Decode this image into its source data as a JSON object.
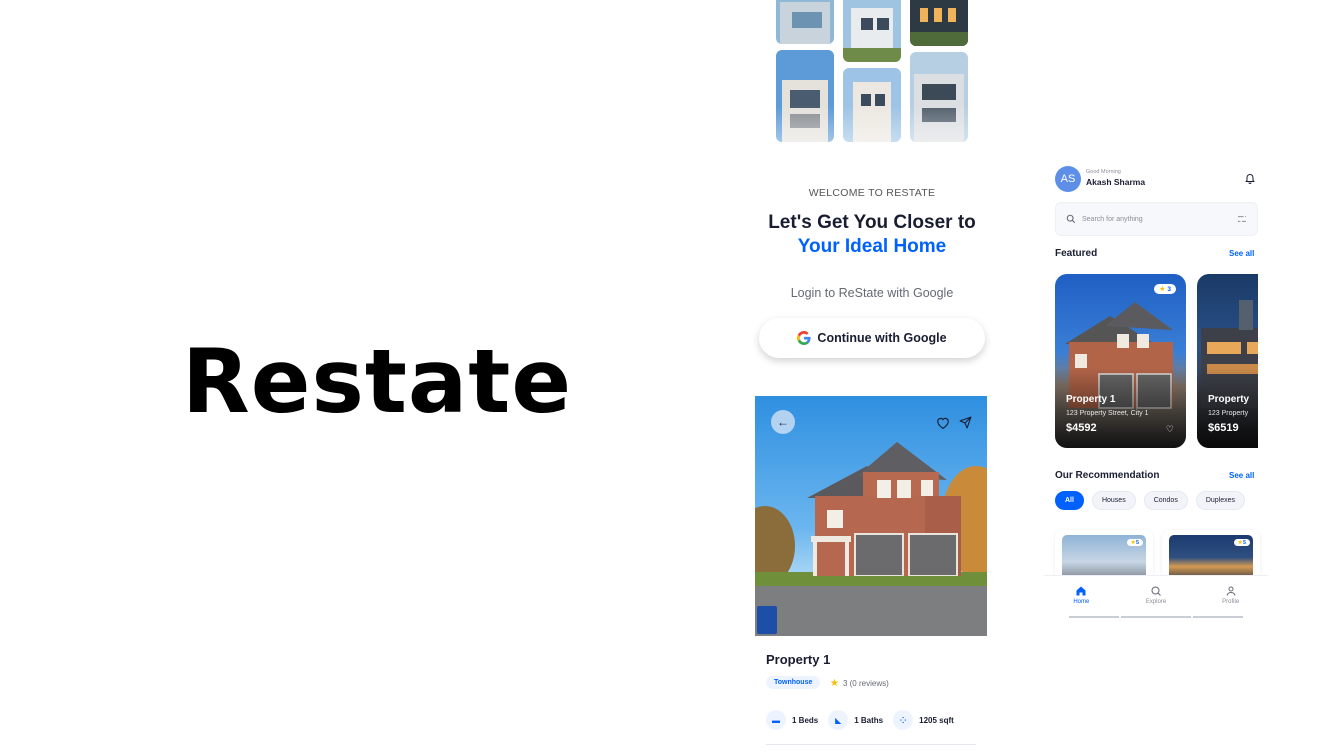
{
  "brand": {
    "title": "Restate"
  },
  "signin": {
    "welcome": "WELCOME TO RESTATE",
    "headline_line1": "Let's Get You Closer to",
    "headline_line2": "Your Ideal Home",
    "login_with": "Login to ReState with Google",
    "google_button": "Continue with Google"
  },
  "detail": {
    "title": "Property 1",
    "tag": "Townhouse",
    "rating": "3 (0 reviews)",
    "facts": [
      {
        "label": "1 Beds",
        "icon": "bed-icon"
      },
      {
        "label": "1 Baths",
        "icon": "bath-icon"
      },
      {
        "label": "1205 sqft",
        "icon": "area-icon"
      }
    ]
  },
  "home": {
    "avatar_initials": "AS",
    "greeting": "Good Morning",
    "user_name": "Akash Sharma",
    "search_placeholder": "Search for anything",
    "featured_title": "Featured",
    "recommendation_title": "Our Recommendation",
    "see_all": "See all",
    "featured_cards": [
      {
        "name": "Property 1",
        "address": "123 Property Street, City 1",
        "price": "$4592",
        "rating": "3"
      },
      {
        "name": "Property",
        "address": "123 Property",
        "price": "$6519"
      }
    ],
    "filters": [
      "All",
      "Houses",
      "Condos",
      "Duplexes"
    ],
    "recommended_cards": [
      {
        "rating": "5"
      },
      {
        "rating": "5"
      }
    ],
    "tabs": [
      "Home",
      "Explore",
      "Profile"
    ]
  },
  "colors": {
    "primary": "#0061ff",
    "text": "#191d31",
    "muted": "#666876"
  }
}
